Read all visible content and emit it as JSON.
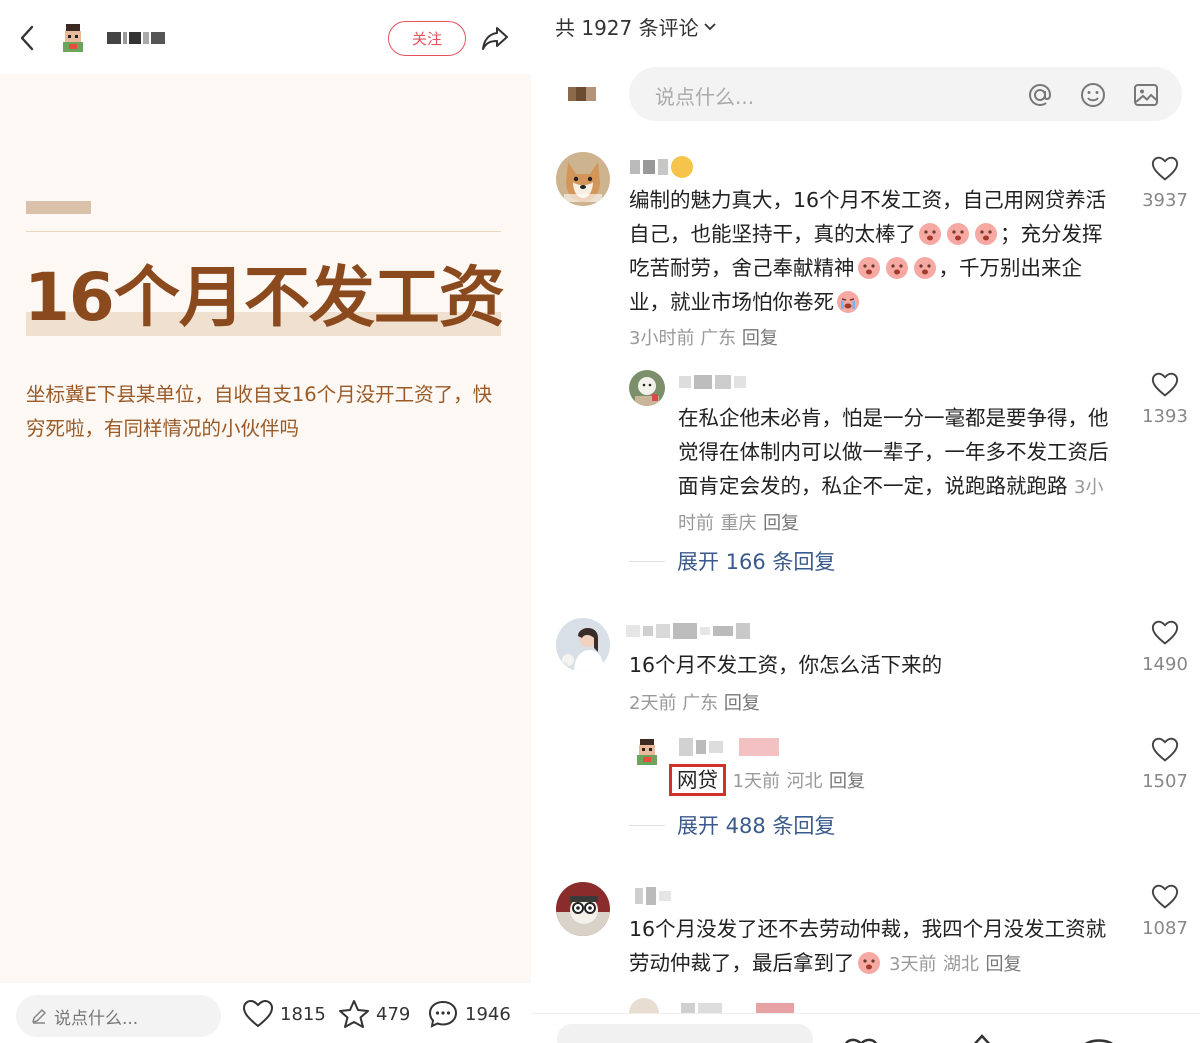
{
  "post": {
    "follow_label": "关注",
    "title": "16个月不发工资",
    "body": "坐标冀E下县某单位，自收自支16个月没开工资了，快穷死啦，有同样情况的小伙伴吗",
    "footer": {
      "input_placeholder": "说点什么...",
      "likes": "1815",
      "favorites": "479",
      "comments": "1946"
    }
  },
  "comments_panel": {
    "count_title": "共 1927 条评论",
    "input_placeholder": "说点什么...",
    "comments": [
      {
        "text_parts": [
          "编制的魅力真大，16个月不发工资，自己用网贷养活自己，也能坚持干，真的太棒了",
          "；充分发挥吃苦耐劳，舍己奉献精神",
          "，千万别出来企业，就业市场怕你卷死"
        ],
        "time": "3小时前",
        "location": "广东",
        "reply": "回复",
        "likes": "3937",
        "replies": [
          {
            "text": "在私企他未必肯，怕是一分一毫都是要争得，他觉得在体制内可以做一辈子，一年多不发工资后面肯定会发的，私企不一定，说跑路就跑路",
            "time": "3小时前",
            "location": "重庆",
            "reply": "回复",
            "likes": "1393"
          }
        ],
        "expand": "展开 166 条回复"
      },
      {
        "text": "16个月不发工资，你怎么活下来的",
        "time": "2天前",
        "location": "广东",
        "reply": "回复",
        "likes": "1490",
        "replies": [
          {
            "text": "网贷",
            "time": "1天前",
            "location": "河北",
            "reply": "回复",
            "likes": "1507"
          }
        ],
        "expand": "展开 488 条回复"
      },
      {
        "text": "16个月没发了还不去劳动仲裁，我四个月没发工资就劳动仲裁了，最后拿到了",
        "time": "3天前",
        "location": "湖北",
        "reply": "回复",
        "likes": "1087"
      }
    ]
  },
  "colors": {
    "accent_red": "#e8525d",
    "title_brown": "#8b4a1e",
    "link_blue": "#3a5a8c"
  },
  "icons": [
    "back-icon",
    "share-icon",
    "heart-icon",
    "star-icon",
    "comment-icon",
    "at-icon",
    "emoji-icon",
    "image-icon",
    "chevron-down-icon",
    "pencil-icon"
  ]
}
